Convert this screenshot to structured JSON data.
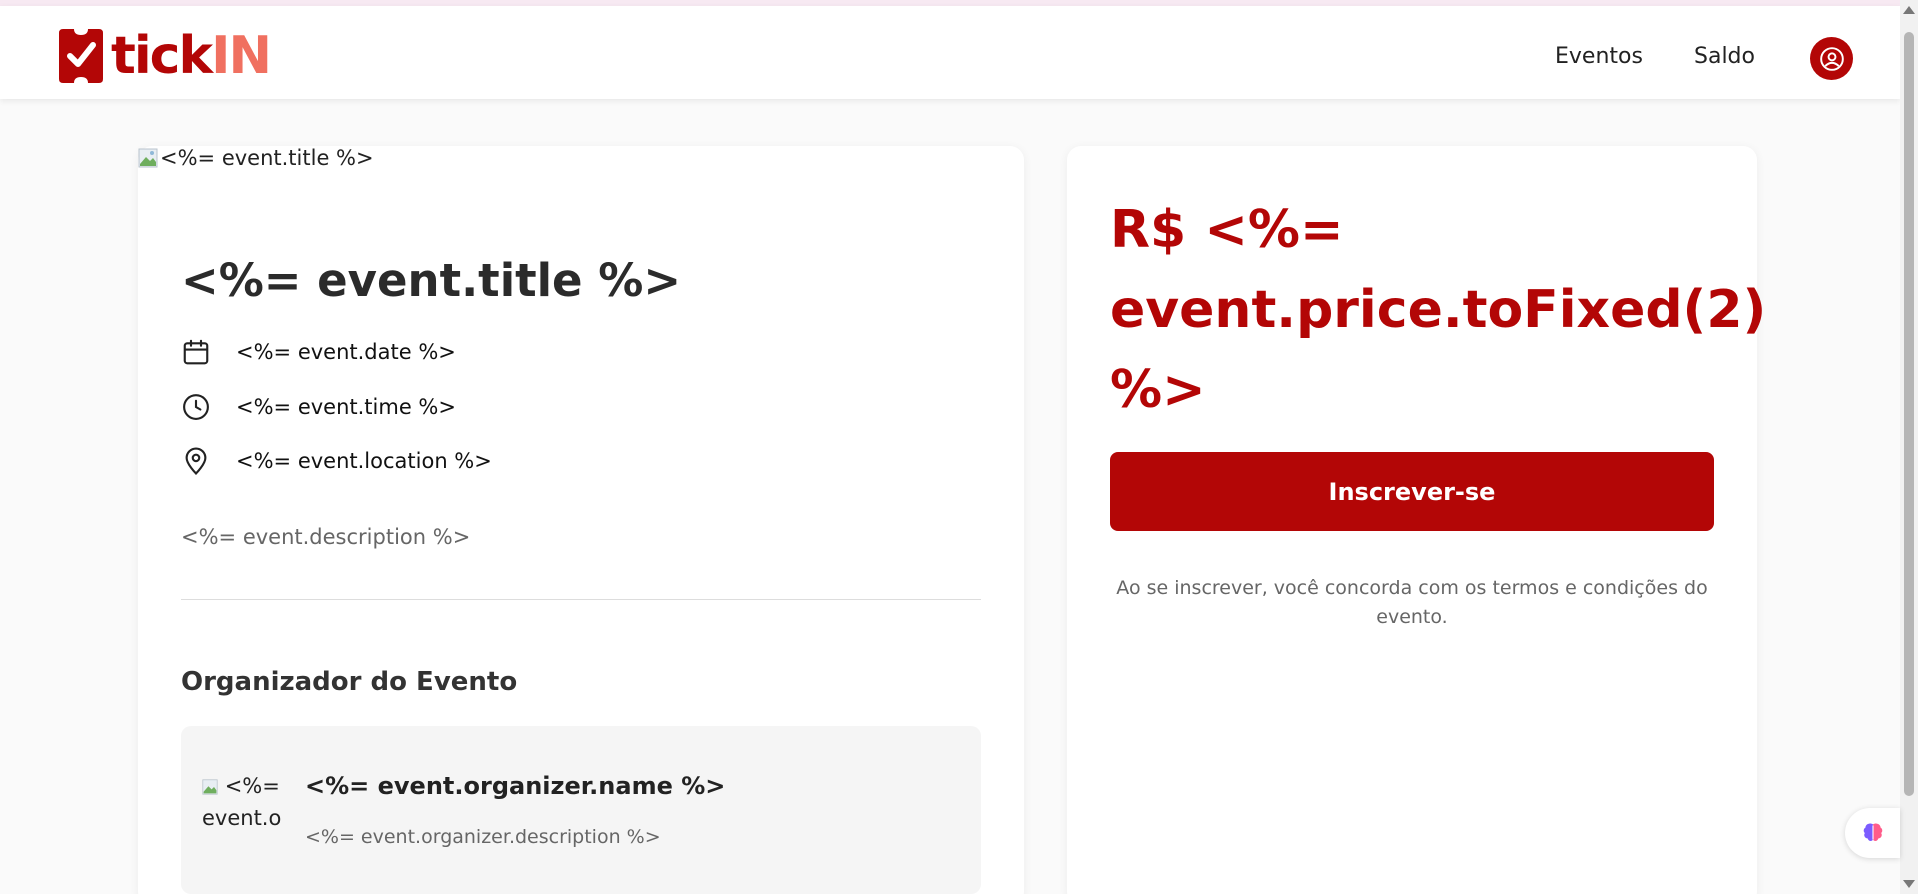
{
  "header": {
    "logo_text_1": "tick",
    "logo_text_2": "IN",
    "nav": [
      {
        "label": "Eventos"
      },
      {
        "label": "Saldo"
      }
    ],
    "profile_icon": "user-circle-icon"
  },
  "event": {
    "image_alt": "<%= event.title %>",
    "title": "<%= event.title %>",
    "date": "<%= event.date %>",
    "time": "<%= event.time %>",
    "location": "<%= event.location %>",
    "description": "<%= event.description %>"
  },
  "organizer": {
    "heading": "Organizador do Evento",
    "image_alt_visible": "<%= event.o",
    "name": "<%= event.organizer.name %>",
    "description": "<%= event.organizer.description %>"
  },
  "purchase": {
    "price": "R$ <%= event.price.toFixed(2) %>",
    "button_label": "Inscrever-se",
    "terms": "Ao se inscrever, você concorda com os termos e condições do evento."
  },
  "colors": {
    "brand": "#b30606",
    "brand_light": "#f07060"
  }
}
